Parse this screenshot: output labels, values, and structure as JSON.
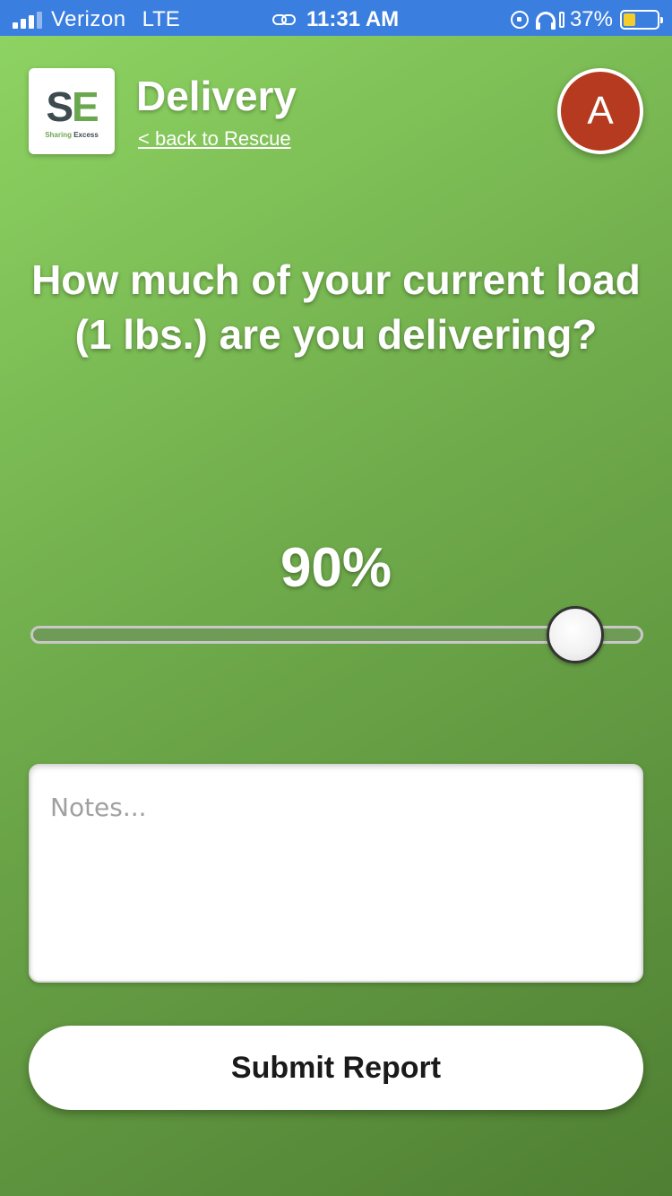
{
  "status_bar": {
    "carrier": "Verizon",
    "network": "LTE",
    "time": "11:31 AM",
    "battery": "37%",
    "battery_level": 0.37
  },
  "header": {
    "logo_text_s": "S",
    "logo_text_e": "E",
    "logo_sub_a": "Sharing",
    "logo_sub_b": "Excess",
    "title": "Delivery",
    "back_link": "< back to Rescue",
    "avatar_initial": "A"
  },
  "main": {
    "question": "How much of your current load (1 lbs.) are you delivering?",
    "percent_label": "90%",
    "slider_value": 0.9,
    "notes_placeholder": "Notes...",
    "notes_value": "",
    "submit_label": "Submit Report"
  },
  "colors": {
    "status_bar": "#3a7ee0",
    "background_start": "#8fd563",
    "background_end": "#4f7f33",
    "avatar": "#b53a1f",
    "brand_green": "#6aa84f",
    "battery_fill": "#f4cd2a"
  },
  "icons": [
    "signal-icon",
    "link-icon",
    "rotation-lock-icon",
    "headphones-icon",
    "battery-icon"
  ]
}
